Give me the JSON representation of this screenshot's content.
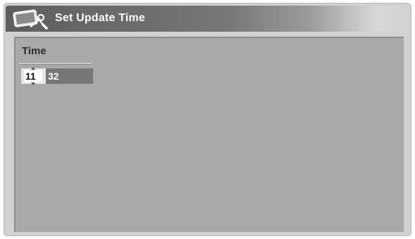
{
  "window": {
    "title": "Set Update Time",
    "icon": "settings-tools-icon"
  },
  "time_field": {
    "label": "Time",
    "hour": "11",
    "minute": "32",
    "selected_segment": "hour"
  },
  "colors": {
    "title_text": "#ffffff",
    "panel_background": "#a9a9a9",
    "time_box_background": "#777777",
    "selected_segment": "#ffffff"
  }
}
